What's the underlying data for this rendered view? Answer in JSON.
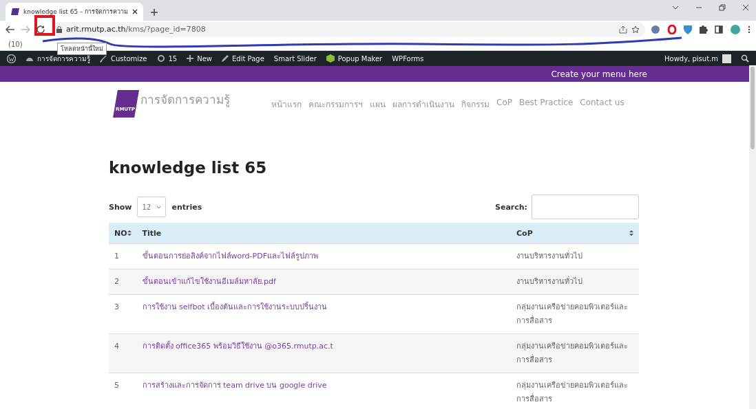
{
  "browser": {
    "tab_title": "knowledge list 65 – การจัดการความ",
    "url_host": "arit.rmutp.ac.th",
    "url_path": "/kms/?page_id=7808",
    "tooltip": "โหลดหน้านี้ใหม่",
    "bookmarks": [
      {
        "label": "(10)"
      }
    ]
  },
  "admin_bar": {
    "items": [
      "การจัดการความรู้",
      "Customize",
      "15",
      "New",
      "Edit Page",
      "Smart Slider",
      "Popup Maker",
      "WPForms"
    ],
    "greeting": "Howdy, pisut.m"
  },
  "top_menu": "Create your menu here",
  "site": {
    "logo_text": "RMUTP",
    "site_name": "การจัดการความรู้",
    "nav": [
      "หน้าแรก",
      "คณะกรรมการฯ",
      "แผน",
      "ผลการดำเนินงาน",
      "กิจกรรม",
      "CoP",
      "Best Practice",
      "Contact us"
    ]
  },
  "page_title": "knowledge list 65",
  "table": {
    "show_label": "Show",
    "entries_value": "12",
    "entries_label": "entries",
    "search_label": "Search:",
    "columns": [
      "NO",
      "Title",
      "CoP"
    ],
    "rows": [
      {
        "no": "1",
        "title": "ขั้นตอนการย่อลิงค์จากไฟล์word-PDFและไฟล์รูปภาพ",
        "cop": "งานบริหารงานทั่วไป"
      },
      {
        "no": "2",
        "title": "ขั้นตอนเข้าแก้ไขใช้งานอีเมล์มหาลัย.pdf",
        "cop": "งานบริหารงานทั่วไป"
      },
      {
        "no": "3",
        "title": "การใช้งาน selfbot เบื้องต้นและการใช้งานระบบปริ้นงาน",
        "cop": "กลุ่มงานเครือข่ายคอมพิวเตอร์และการสื่อสาร"
      },
      {
        "no": "4",
        "title": "การติดตั้ง office365 พร้อมวิธีใช้งาน @o365.rmutp.ac.t",
        "cop": "กลุ่มงานเครือข่ายคอมพิวเตอร์และการสื่อสาร"
      },
      {
        "no": "5",
        "title": "การสร้างและการจัดการ team drive บน google drive",
        "cop": "กลุ่มงานเครือข่ายคอมพิวเตอร์และการสื่อสาร"
      }
    ]
  }
}
